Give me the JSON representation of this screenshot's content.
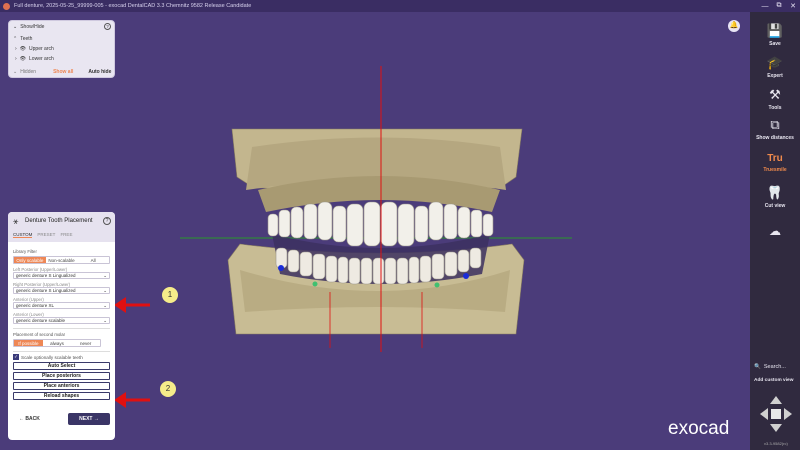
{
  "titlebar": {
    "title": "Full denture, 2025-05-25_99999-005 - exocad DentalCAD 3.3 Chemnitz 9582 Release Candidate",
    "min": "—",
    "max": "⧉",
    "close": "✕"
  },
  "show_hide": {
    "title": "Show/Hide",
    "help": "?",
    "teeth": "Teeth",
    "upper_arch": "Upper arch",
    "lower_arch": "Lower arch",
    "hidden": "Hidden",
    "show_all": "Show all",
    "auto_hide": "Auto hide"
  },
  "placement": {
    "title": "Denture Tooth Placement",
    "help": "?",
    "tabs": [
      "CUSTOM",
      "PRESET",
      "FREE"
    ],
    "library_filter_label": "Library Filter",
    "filter_options": [
      "Only scalable",
      "Non-scalable",
      "All"
    ],
    "left_posterior_label": "Left Posterior (Upper/Lower)",
    "left_posterior_value": "generic denture S Lingualized",
    "right_posterior_label": "Right Posterior (Upper/Lower)",
    "right_posterior_value": "generic denture S Lingualized",
    "anterior_upper_label": "Anterior (Upper)",
    "anterior_upper_value": "generic denture XL",
    "anterior_lower_label": "Anterior (Lower)",
    "anterior_lower_value": "generic denture scalable",
    "second_molar_label": "Placement of second molar",
    "second_molar_options": [
      "If possible",
      "always",
      "never"
    ],
    "scale_checkbox_label": "Scale optionally scalable teeth",
    "auto_select": "Auto Select",
    "place_posteriors": "Place posteriors",
    "place_anteriors": "Place anteriors",
    "reload_shapes": "Reload shapes",
    "back": "BACK",
    "next": "NEXT"
  },
  "annotations": [
    "1",
    "2"
  ],
  "sidebar": {
    "save": "Save",
    "expert": "Expert",
    "tools": "Tools",
    "show_distances": "Show distances",
    "truesmile_logo": "Tru",
    "truesmile": "Truesmile",
    "cut_view": "Cut view",
    "search": "Search...",
    "add_custom_view": "Add custom view",
    "version": "v3.3-9582(rc)"
  },
  "brand": "exocad",
  "colors": {
    "background": "#4b3c7a",
    "accent": "#ee8755",
    "arrow_red": "#e01010",
    "model": "#c8bd96"
  }
}
